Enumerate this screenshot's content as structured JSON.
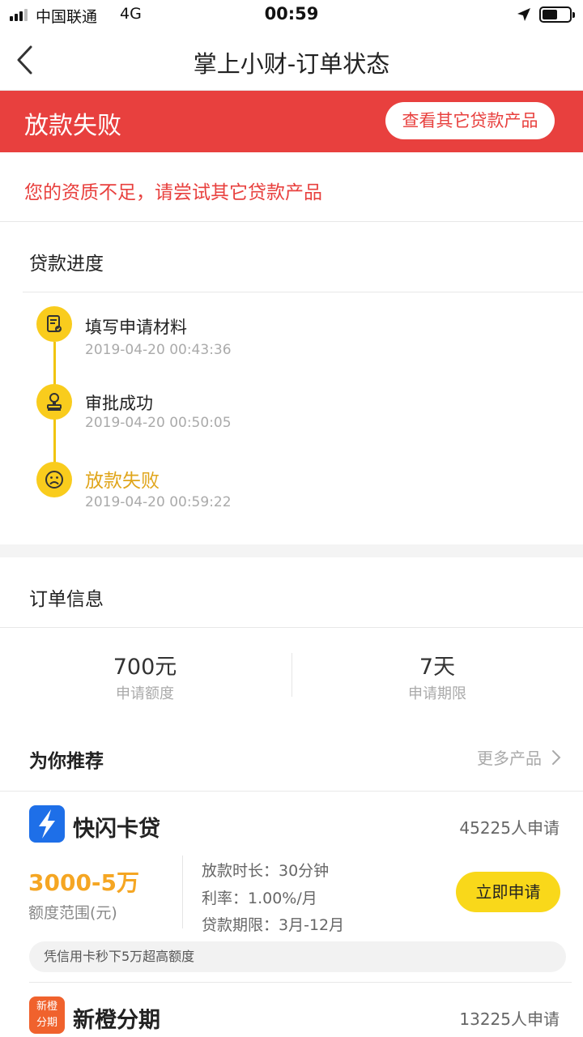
{
  "status_bar": {
    "carrier": "中国联通",
    "network": "4G",
    "time": "00:59"
  },
  "nav": {
    "title": "掌上小财-订单状态",
    "back_icon": "chevron-left-icon"
  },
  "banner": {
    "title": "放款失败",
    "button_label": "查看其它贷款产品",
    "color": "#e8403e"
  },
  "reason": "您的资质不足，请尝试其它贷款产品",
  "progress": {
    "title": "贷款进度",
    "steps": [
      {
        "label": "填写申请材料",
        "time": "2019-04-20 00:43:36",
        "icon": "document-check-icon"
      },
      {
        "label": "审批成功",
        "time": "2019-04-20 00:50:05",
        "icon": "stamp-icon"
      },
      {
        "label": "放款失败",
        "time": "2019-04-20 00:59:22",
        "icon": "sad-face-icon"
      }
    ]
  },
  "order": {
    "title": "订单信息",
    "amount_value": "700元",
    "amount_label": "申请额度",
    "term_value": "7天",
    "term_label": "申请期限"
  },
  "recommend": {
    "title": "为你推荐",
    "more_label": "更多产品",
    "products": [
      {
        "name": "快闪卡贷",
        "applicants": "45225人申请",
        "amount": "3000-5万",
        "amount_label": "额度范围(元)",
        "details": [
          "放款时长：30分钟",
          "利率：1.00%/月",
          "贷款期限：3月-12月"
        ],
        "apply_label": "立即申请",
        "tagline": "凭信用卡秒下5万超高额度",
        "logo": "lightning-icon"
      },
      {
        "name": "新橙分期",
        "applicants": "13225人申请",
        "logo_text_1": "新橙",
        "logo_text_2": "分期",
        "logo": "xincheng-logo"
      }
    ]
  }
}
